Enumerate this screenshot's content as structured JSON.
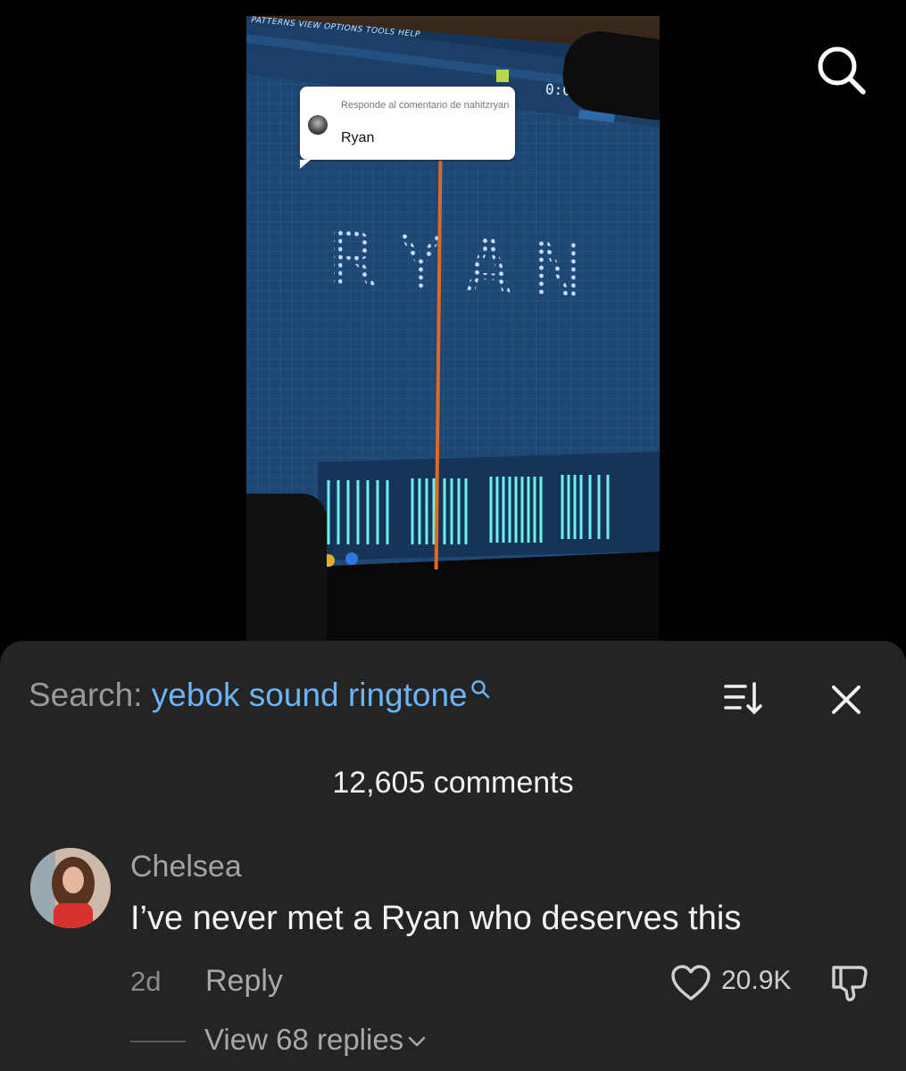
{
  "video": {
    "menu_text": "PATTERNS VIEW OPTIONS TOOLS HELP",
    "clock": "0:04:35",
    "big_text": "RYAN",
    "reply_card": {
      "label": "Responde al comentario de nahitzryan",
      "text": "Ryan"
    }
  },
  "top_search_icon": "search-icon",
  "comments_panel": {
    "search_prefix": "Search:",
    "search_query": "yebok sound ringtone",
    "count_label": "12,605 comments",
    "comment": {
      "username": "Chelsea",
      "text": "I’ve never met a Ryan who deserves this",
      "age": "2d",
      "reply_label": "Reply",
      "like_count": "20.9K",
      "view_replies": "View 68 replies"
    }
  },
  "colors": {
    "sheet_bg": "#242424",
    "search_link": "#6cb4f5",
    "screen_blue": "#1d3f6b"
  }
}
